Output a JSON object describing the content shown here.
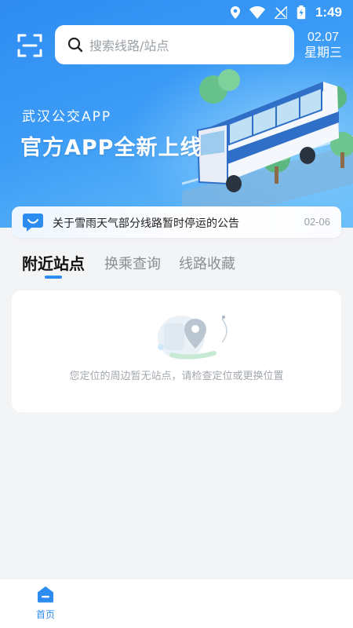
{
  "status_bar": {
    "time": "1:49"
  },
  "search": {
    "placeholder": "搜索线路/站点"
  },
  "date": {
    "day": "02.07",
    "weekday": "星期三"
  },
  "banner": {
    "subtitle": "武汉公交APP",
    "title": "官方APP全新上线"
  },
  "notice": {
    "text": "关于雪雨天气部分线路暂时停运的公告",
    "date": "02-06"
  },
  "tabs": [
    {
      "label": "附近站点",
      "active": true
    },
    {
      "label": "换乘查询",
      "active": false
    },
    {
      "label": "线路收藏",
      "active": false
    }
  ],
  "nearby": {
    "empty_text": "您定位的周边暂无站点，请检查定位或更换位置"
  },
  "bottom_nav": {
    "home_label": "首页"
  },
  "colors": {
    "accent": "#2d8cf0",
    "banner": "#3c9cf6"
  },
  "icons": [
    "location-icon",
    "wifi-icon",
    "signal-icon",
    "battery-icon",
    "scan-icon",
    "search-icon",
    "message-icon",
    "home-icon"
  ]
}
